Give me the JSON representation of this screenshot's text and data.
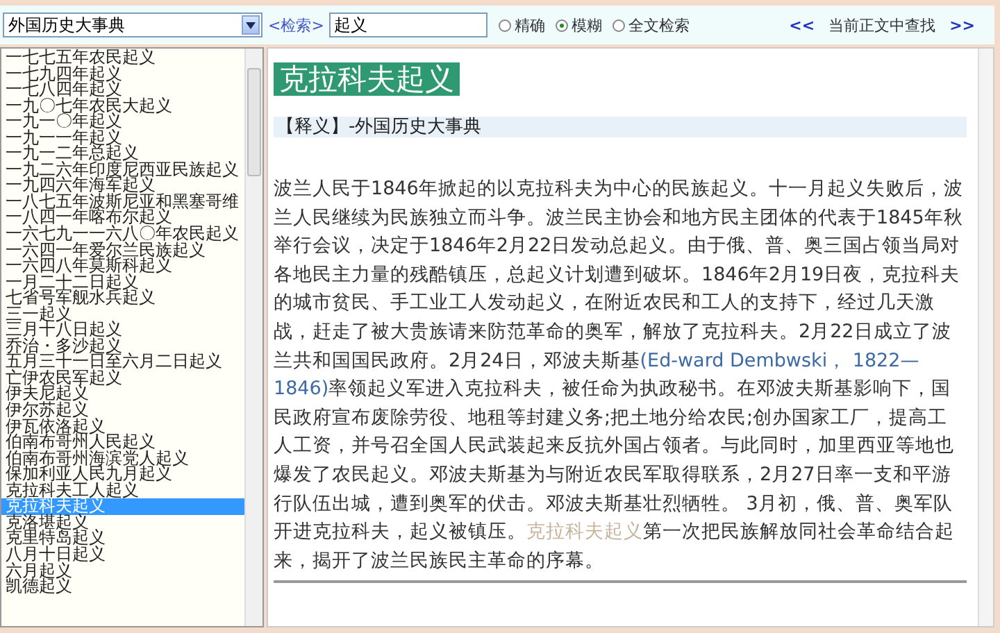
{
  "toolbar": {
    "dictionary": "外国历史大事典",
    "search_label": "<检索>",
    "query": "起义",
    "modes": [
      {
        "label": "精确",
        "selected": false
      },
      {
        "label": "模糊",
        "selected": true
      },
      {
        "label": "全文检索",
        "selected": false
      }
    ],
    "find_prev": "<<",
    "find_label": "当前正文中查找",
    "find_next": ">>"
  },
  "entries": [
    {
      "label": "一七七五年农民起义",
      "selected": false
    },
    {
      "label": "一七九四年起义",
      "selected": false
    },
    {
      "label": "一七八四年起义",
      "selected": false
    },
    {
      "label": "一九〇七年农民大起义",
      "selected": false
    },
    {
      "label": "一九一〇年起义",
      "selected": false
    },
    {
      "label": "一九一一年起义",
      "selected": false
    },
    {
      "label": "一九一二年总起义",
      "selected": false
    },
    {
      "label": "一九二六年印度尼西亚民族起义",
      "selected": false
    },
    {
      "label": "一九四六年海军起义",
      "selected": false
    },
    {
      "label": "一八七五年波斯尼亚和黑塞哥维",
      "selected": false
    },
    {
      "label": "一八四一年喀布尔起义",
      "selected": false
    },
    {
      "label": "一六七九一一六八〇年农民起义",
      "selected": false
    },
    {
      "label": "一六四一年爱尔兰民族起义",
      "selected": false
    },
    {
      "label": "一六四八年莫斯科起义",
      "selected": false
    },
    {
      "label": "一月二十二日起义",
      "selected": false
    },
    {
      "label": "七省号军舰水兵起义",
      "selected": false
    },
    {
      "label": "三一起义",
      "selected": false
    },
    {
      "label": "三月十八日起义",
      "selected": false
    },
    {
      "label": "乔治・多沙起义",
      "selected": false
    },
    {
      "label": "五月三十一日至六月二日起义",
      "selected": false
    },
    {
      "label": "亡伊农民军起义",
      "selected": false
    },
    {
      "label": "伊夫尼起义",
      "selected": false
    },
    {
      "label": "伊尔苏起义",
      "selected": false
    },
    {
      "label": "伊瓦依洛起义",
      "selected": false
    },
    {
      "label": "伯南布哥州人民起义",
      "selected": false
    },
    {
      "label": "伯南布哥州海滨党人起义",
      "selected": false
    },
    {
      "label": "保加利亚人民九月起义",
      "selected": false
    },
    {
      "label": "克拉科夫工人起义",
      "selected": false
    },
    {
      "label": "克拉科夫起义",
      "selected": true
    },
    {
      "label": "克洛堪起义",
      "selected": false
    },
    {
      "label": "克里特岛起义",
      "selected": false
    },
    {
      "label": "八月十日起义",
      "selected": false
    },
    {
      "label": "六月起义",
      "selected": false
    },
    {
      "label": "凯德起义",
      "selected": false
    }
  ],
  "article": {
    "title": "克拉科夫起义",
    "source": "【释义】-外国历史大事典",
    "body": [
      {
        "kind": "text",
        "text": "波兰人民于1846年掀起的以克拉科夫为中心的民族起义。十一月起义失败后，波兰人民继续为民族独立而斗争。波兰民主协会和地方民主团体的代表于1845年秋举行会议，决定于1846年2月22日发动总起义。由于俄、普、奥三国占领当局对各地民主力量的残酷镇压，总起义计划遭到破坏。1846年2月19日夜，克拉科夫的城市贫民、手工业工人发动起义，在附近农民和工人的支持下，经过几天激战，赶走了被大贵族请来防范革命的奥军，解放了克拉科夫。2月22日成立了波兰共和国国民政府。2月24日，邓波夫斯基"
      },
      {
        "kind": "foreign",
        "text": "(Ed-ward Dembwski， 1822—1846)"
      },
      {
        "kind": "text",
        "text": "率领起义军进入克拉科夫，被任命为执政秘书。在邓波夫斯基影响下，国民政府宣布废除劳役、地租等封建义务;把土地分给农民;创办国家工厂，提高工人工资，并号召全国人民武装起来反抗外国占领者。与此同时，加里西亚等地也爆发了农民起义。邓波夫斯基为与附近农民军取得联系，2月27日率一支和平游行队伍出城，遭到奥军的伏击。邓波夫斯基壮烈牺牲。 3月初，俄、普、奥军队开进克拉科夫，起义被镇压。"
      },
      {
        "kind": "headword",
        "text": "克拉科夫起义"
      },
      {
        "kind": "text",
        "text": "第一次把民族解放同社会革命结合起来，揭开了波兰民族民主革命的序幕。"
      }
    ]
  }
}
